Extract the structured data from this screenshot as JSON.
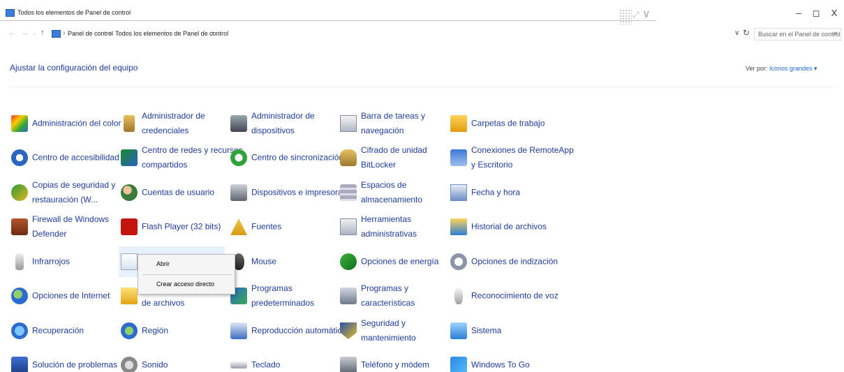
{
  "window": {
    "title": "Todos los elementos de Panel de control",
    "minimize": "–",
    "maximize": "◻",
    "close": "X"
  },
  "address": {
    "crumbs": [
      "Panel de control",
      "Todos los elementos de Panel de control"
    ],
    "search_placeholder": "Buscar en el Panel de control"
  },
  "header": {
    "heading": "Ajustar la configuración del equipo",
    "view_by_label": "Ver por:",
    "view_by_value": "Iconos grandes ▾"
  },
  "items": [
    {
      "line1": "Administración del color",
      "line2": ""
    },
    {
      "line1": "Administrador de",
      "line2": "credenciales"
    },
    {
      "line1": "Administrador de",
      "line2": "dispositivos"
    },
    {
      "line1": "Barra de tareas y",
      "line2": "navegación"
    },
    {
      "line1": "Carpetas de trabajo",
      "line2": ""
    },
    {
      "line1": "Centro de accesibilidad",
      "line2": ""
    },
    {
      "line1": "Centro de redes y recursos",
      "line2": "compartidos"
    },
    {
      "line1": "Centro de sincronización",
      "line2": ""
    },
    {
      "line1": "Cifrado de unidad",
      "line2": "BitLocker"
    },
    {
      "line1": "Conexiones de RemoteApp",
      "line2": "y Escritorio"
    },
    {
      "line1": "Copias de seguridad y",
      "line2": "restauración (W..."
    },
    {
      "line1": "Cuentas de usuario",
      "line2": ""
    },
    {
      "line1": "Dispositivos e impresoras",
      "line2": ""
    },
    {
      "line1": "Espacios de",
      "line2": "almacenamiento"
    },
    {
      "line1": "Fecha y hora",
      "line2": ""
    },
    {
      "line1": "Firewall de Windows",
      "line2": "Defender"
    },
    {
      "line1": "Flash Player (32 bits)",
      "line2": ""
    },
    {
      "line1": "Fuentes",
      "line2": ""
    },
    {
      "line1": "Herramientas",
      "line2": "administrativas"
    },
    {
      "line1": "Historial de archivos",
      "line2": ""
    },
    {
      "line1": "Infrarrojos",
      "line2": ""
    },
    {
      "line1": "",
      "line2": ""
    },
    {
      "line1": "Mouse",
      "line2": ""
    },
    {
      "line1": "Opciones de energía",
      "line2": ""
    },
    {
      "line1": "Opciones de indización",
      "line2": ""
    },
    {
      "line1": "Opciones de Internet",
      "line2": ""
    },
    {
      "line1": "",
      "line2": "de archivos"
    },
    {
      "line1": "Programas",
      "line2": "predeterminados"
    },
    {
      "line1": "Programas y",
      "line2": "características"
    },
    {
      "line1": "Reconocimiento de voz",
      "line2": ""
    },
    {
      "line1": "Recuperación",
      "line2": ""
    },
    {
      "line1": "Región",
      "line2": ""
    },
    {
      "line1": "Reproducción automática",
      "line2": ""
    },
    {
      "line1": "Seguridad y",
      "line2": "mantenimiento"
    },
    {
      "line1": "Sistema",
      "line2": ""
    },
    {
      "line1": "Solución de problemas",
      "line2": ""
    },
    {
      "line1": "Sonido",
      "line2": ""
    },
    {
      "line1": "Teclado",
      "line2": ""
    },
    {
      "line1": "Teléfono y módem",
      "line2": ""
    },
    {
      "line1": "Windows To Go",
      "line2": ""
    }
  ],
  "icons": [
    "color-management-icon",
    "credential-manager-icon",
    "device-manager-icon",
    "taskbar-icon",
    "work-folders-icon",
    "ease-of-access-icon",
    "network-center-icon",
    "sync-center-icon",
    "bitlocker-icon",
    "remoteapp-icon",
    "backup-restore-icon",
    "user-accounts-icon",
    "devices-printers-icon",
    "storage-spaces-icon",
    "date-time-icon",
    "firewall-icon",
    "flash-player-icon",
    "fonts-icon",
    "admin-tools-icon",
    "file-history-icon",
    "infrared-icon",
    "java-icon",
    "mouse-icon",
    "power-options-icon",
    "indexing-options-icon",
    "internet-options-icon",
    "file-explorer-options-icon",
    "default-programs-icon",
    "programs-features-icon",
    "speech-recognition-icon",
    "recovery-icon",
    "region-icon",
    "autoplay-icon",
    "security-maintenance-icon",
    "system-icon",
    "troubleshooting-icon",
    "sound-icon",
    "keyboard-icon",
    "phone-modem-icon",
    "windows-to-go-icon"
  ],
  "context_menu": {
    "open": "Abrir",
    "create_shortcut": "Crear acceso directo"
  }
}
